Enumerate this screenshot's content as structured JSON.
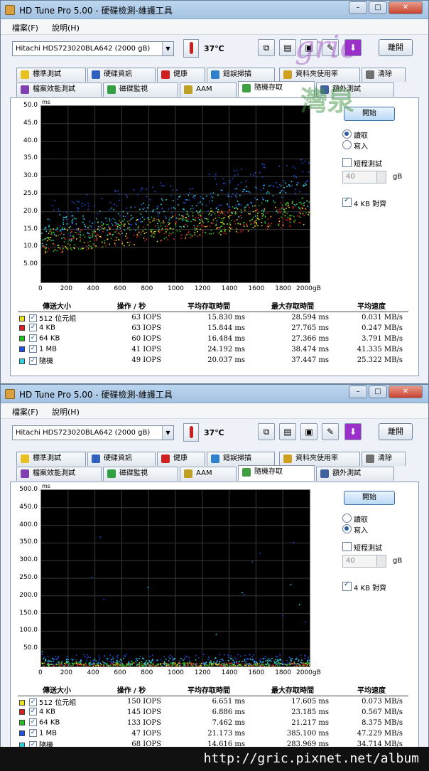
{
  "footer": {
    "url": "http://gric.pixnet.net/album"
  },
  "watermark": {
    "line1": "gric",
    "line2": "灣泉"
  },
  "windows": [
    {
      "title": "HD Tune Pro  5.00 - 硬碟檢測-維護工具",
      "menu": [
        "檔案(F)",
        "說明(H)"
      ],
      "drive": "Hitachi HDS723020BLA642  (2000 gB)",
      "temperature": "37℃",
      "exit_label": "離開",
      "tabs_row1": [
        "標準測試",
        "硬碟資訊",
        "健康",
        "錯誤掃描",
        "資料夾使用率",
        "清除"
      ],
      "tabs_row2": [
        "檔案效能測試",
        "磁碟監視",
        "AAM",
        "隨機存取",
        "額外測試"
      ],
      "active_tab": "隨機存取",
      "start_label": "開始",
      "read_label": "讀取",
      "write_label": "寫入",
      "mode": "read",
      "short_stroke_label": "短程測試",
      "short_stroke_value": "40",
      "short_stroke_unit": "gB",
      "align_label": "4 KB 對齊",
      "chart_data": {
        "type": "scatter",
        "ylabel": "ms",
        "xlabel": "gB",
        "yticks": [
          "50.0",
          "45.0",
          "40.0",
          "35.0",
          "30.0",
          "25.0",
          "20.0",
          "15.0",
          "10.0",
          "5.00"
        ],
        "xticks": [
          "0",
          "200",
          "400",
          "600",
          "800",
          "1000",
          "1200",
          "1400",
          "1600",
          "1800",
          "2000gB"
        ],
        "ylim": [
          0,
          50
        ],
        "xlim": [
          0,
          2000
        ],
        "grid": true,
        "series": [
          {
            "name": "512 位元組",
            "color": "#e8e020",
            "avg_ms": 15.83,
            "max_ms": 28.594
          },
          {
            "name": "4 KB",
            "color": "#d82020",
            "avg_ms": 15.844,
            "max_ms": 27.765
          },
          {
            "name": "64 KB",
            "color": "#20c020",
            "avg_ms": 16.484,
            "max_ms": 27.366
          },
          {
            "name": "1 MB",
            "color": "#2050e0",
            "avg_ms": 24.192,
            "max_ms": 38.474
          },
          {
            "name": "隨機",
            "color": "#30d0e0",
            "avg_ms": 20.037,
            "max_ms": 37.447
          }
        ]
      },
      "table": {
        "headers": [
          "傳送大小",
          "操作 / 秒",
          "平均存取時間",
          "最大存取時間",
          "平均速度"
        ],
        "rows": [
          {
            "size": "512 位元組",
            "color": "#e8e020",
            "ops": "63 IOPS",
            "avg": "15.830 ms",
            "max": "28.594 ms",
            "speed": "0.031 MB/s"
          },
          {
            "size": "4 KB",
            "color": "#d82020",
            "ops": "63 IOPS",
            "avg": "15.844 ms",
            "max": "27.765 ms",
            "speed": "0.247 MB/s"
          },
          {
            "size": "64 KB",
            "color": "#20c020",
            "ops": "60 IOPS",
            "avg": "16.484 ms",
            "max": "27.366 ms",
            "speed": "3.791 MB/s"
          },
          {
            "size": "1 MB",
            "color": "#2050e0",
            "ops": "41 IOPS",
            "avg": "24.192 ms",
            "max": "38.474 ms",
            "speed": "41.335 MB/s"
          },
          {
            "size": "隨機",
            "color": "#30d0e0",
            "ops": "49 IOPS",
            "avg": "20.037 ms",
            "max": "37.447 ms",
            "speed": "25.322 MB/s"
          }
        ]
      }
    },
    {
      "title": "HD Tune Pro  5.00 - 硬碟檢測-維護工具",
      "menu": [
        "檔案(F)",
        "說明(H)"
      ],
      "drive": "Hitachi HDS723020BLA642  (2000 gB)",
      "temperature": "37℃",
      "exit_label": "離開",
      "tabs_row1": [
        "標準測試",
        "硬碟資訊",
        "健康",
        "錯誤掃描",
        "資料夾使用率",
        "清除"
      ],
      "tabs_row2": [
        "檔案效能測試",
        "磁碟監視",
        "AAM",
        "隨機存取",
        "額外測試"
      ],
      "active_tab": "隨機存取",
      "start_label": "開始",
      "read_label": "讀取",
      "write_label": "寫入",
      "mode": "write",
      "short_stroke_label": "短程測試",
      "short_stroke_value": "40",
      "short_stroke_unit": "gB",
      "align_label": "4 KB 對齊",
      "chart_data": {
        "type": "scatter",
        "ylabel": "ms",
        "xlabel": "gB",
        "yticks": [
          "500.0",
          "450.0",
          "400.0",
          "350.0",
          "300.0",
          "250.0",
          "200.0",
          "150.0",
          "100.0",
          "50.0"
        ],
        "xticks": [
          "0",
          "200",
          "400",
          "600",
          "800",
          "1000",
          "1200",
          "1400",
          "1600",
          "1800",
          "2000gB"
        ],
        "ylim": [
          0,
          500
        ],
        "xlim": [
          0,
          2000
        ],
        "grid": true,
        "series": [
          {
            "name": "512 位元組",
            "color": "#e8e020",
            "avg_ms": 6.651,
            "max_ms": 17.605
          },
          {
            "name": "4 KB",
            "color": "#d82020",
            "avg_ms": 6.886,
            "max_ms": 23.185
          },
          {
            "name": "64 KB",
            "color": "#20c020",
            "avg_ms": 7.462,
            "max_ms": 21.217
          },
          {
            "name": "1 MB",
            "color": "#2050e0",
            "avg_ms": 21.173,
            "max_ms": 385.1
          },
          {
            "name": "隨機",
            "color": "#30d0e0",
            "avg_ms": 14.616,
            "max_ms": 283.969
          }
        ]
      },
      "table": {
        "headers": [
          "傳送大小",
          "操作 / 秒",
          "平均存取時間",
          "最大存取時間",
          "平均速度"
        ],
        "rows": [
          {
            "size": "512 位元組",
            "color": "#e8e020",
            "ops": "150 IOPS",
            "avg": "6.651 ms",
            "max": "17.605 ms",
            "speed": "0.073 MB/s"
          },
          {
            "size": "4 KB",
            "color": "#d82020",
            "ops": "145 IOPS",
            "avg": "6.886 ms",
            "max": "23.185 ms",
            "speed": "0.567 MB/s"
          },
          {
            "size": "64 KB",
            "color": "#20c020",
            "ops": "133 IOPS",
            "avg": "7.462 ms",
            "max": "21.217 ms",
            "speed": "8.375 MB/s"
          },
          {
            "size": "1 MB",
            "color": "#2050e0",
            "ops": "47 IOPS",
            "avg": "21.173 ms",
            "max": "385.100 ms",
            "speed": "47.229 MB/s"
          },
          {
            "size": "隨機",
            "color": "#30d0e0",
            "ops": "68 IOPS",
            "avg": "14.616 ms",
            "max": "283.969 ms",
            "speed": "34.714 MB/s"
          }
        ]
      }
    }
  ]
}
